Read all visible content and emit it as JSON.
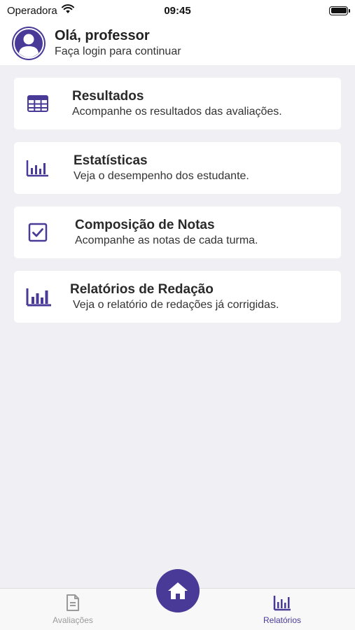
{
  "status": {
    "carrier": "Operadora",
    "time": "09:45"
  },
  "header": {
    "greeting": "Olá, professor",
    "subtitle": "Faça login para continuar"
  },
  "cards": [
    {
      "title": "Resultados",
      "description": "Acompanhe os resultados das avaliações.",
      "icon": "table-icon"
    },
    {
      "title": "Estatísticas",
      "description": "Veja o desempenho dos estudante.",
      "icon": "bar-chart-icon"
    },
    {
      "title": "Composição de Notas",
      "description": "Acompanhe as notas de cada turma.",
      "icon": "checkbox-icon"
    },
    {
      "title": "Relatórios de Redação",
      "description": "Veja o relatório de redações já corrigidas.",
      "icon": "bar-chart-icon"
    }
  ],
  "tabs": {
    "left": {
      "label": "Avaliações",
      "icon": "document-icon",
      "active": false
    },
    "right": {
      "label": "Relatórios",
      "icon": "bar-chart-icon",
      "active": true
    },
    "center": {
      "icon": "home-icon"
    }
  },
  "colors": {
    "accent": "#4a3a98",
    "inactive": "#9a9a9a",
    "background": "#efeff4"
  }
}
